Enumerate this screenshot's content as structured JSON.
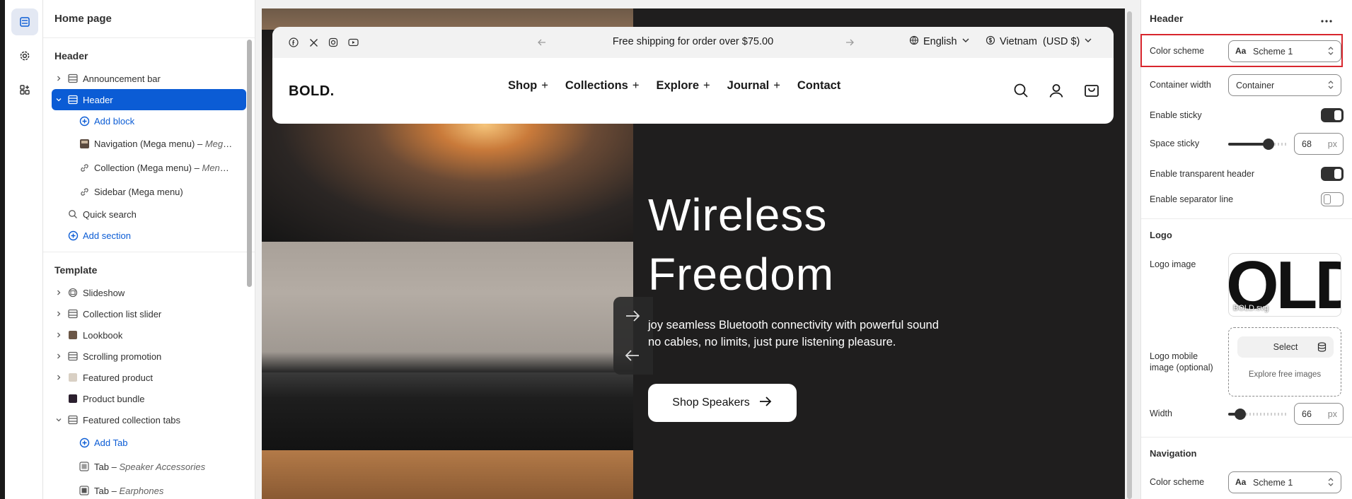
{
  "rail": {
    "icons": [
      "sections-icon",
      "settings-icon",
      "apps-icon"
    ]
  },
  "left_panel": {
    "title": "Home page",
    "header_section_label": "Header",
    "header_items": [
      {
        "label": "Announcement bar",
        "kind": "section"
      },
      {
        "label": "Header",
        "kind": "section",
        "selected": true
      },
      {
        "label": "Add block",
        "kind": "add"
      },
      {
        "label": "Navigation (Mega menu)",
        "suffix": "Mega...",
        "kind": "block"
      },
      {
        "label": "Collection (Mega menu)",
        "suffix": "Menu ...",
        "kind": "block"
      },
      {
        "label": "Sidebar (Mega menu)",
        "kind": "block"
      },
      {
        "label": "Quick search",
        "kind": "section"
      },
      {
        "label": "Add section",
        "kind": "add"
      }
    ],
    "template_label": "Template",
    "template_items": [
      {
        "label": "Slideshow"
      },
      {
        "label": "Collection list slider"
      },
      {
        "label": "Lookbook"
      },
      {
        "label": "Scrolling promotion"
      },
      {
        "label": "Featured product"
      },
      {
        "label": "Product bundle"
      },
      {
        "label": "Featured collection tabs"
      },
      {
        "label": "Add Tab"
      },
      {
        "label": "Tab",
        "suffix": "Speaker Accessories"
      },
      {
        "label": "Tab",
        "suffix": "Earphones"
      }
    ]
  },
  "preview": {
    "announcement": "Free shipping for order over $75.00",
    "language": "English",
    "currency": "Vietnam  (USD $)",
    "logo": "BOLD.",
    "menu": [
      "Shop",
      "Collections",
      "Explore",
      "Journal",
      "Contact"
    ],
    "hero_title_1": "Wireless",
    "hero_title_2": "Freedom",
    "hero_sub_1": "joy seamless Bluetooth connectivity with powerful sound",
    "hero_sub_2": "no cables, no limits, just pure listening pleasure.",
    "hero_button": "Shop Speakers"
  },
  "right_panel": {
    "title": "Header",
    "color_scheme_label": "Color scheme",
    "color_scheme_value": "Scheme 1",
    "container_width_label": "Container width",
    "container_width_value": "Container",
    "enable_sticky_label": "Enable sticky",
    "enable_sticky": true,
    "space_sticky_label": "Space sticky",
    "space_sticky_value": "68",
    "space_sticky_fraction": 0.68,
    "unit": "px",
    "transparent_label": "Enable transparent header",
    "transparent": true,
    "separator_label": "Enable separator line",
    "separator": false,
    "logo_heading": "Logo",
    "logo_image_label": "Logo image",
    "logo_thumb_text": "OLD",
    "logo_filename": "BOLD.svg",
    "logo_mobile_label_1": "Logo mobile",
    "logo_mobile_label_2": "image (optional)",
    "select_label": "Select",
    "explore_label": "Explore free images",
    "width_label": "Width",
    "width_value": "66",
    "width_fraction": 0.2,
    "navigation_heading": "Navigation",
    "nav_color_scheme_label": "Color scheme",
    "nav_color_scheme_value": "Scheme 1",
    "aa_glyph": "Aa"
  },
  "colors": {
    "accent": "#0b5cd5",
    "highlight": "#d8262d"
  }
}
